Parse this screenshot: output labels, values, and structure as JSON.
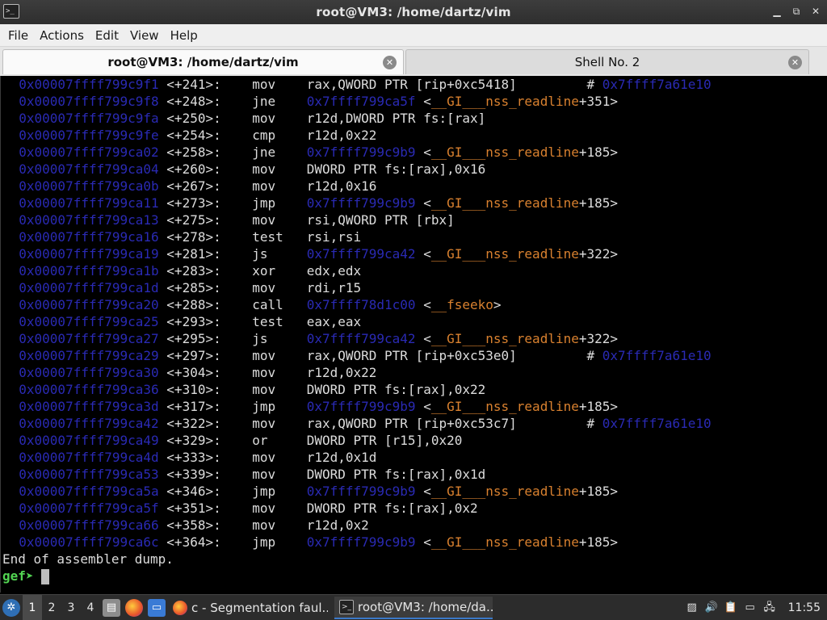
{
  "window": {
    "title": "root@VM3: /home/dartz/vim",
    "app_icon": ">_"
  },
  "menu": [
    "File",
    "Actions",
    "Edit",
    "View",
    "Help"
  ],
  "tabs": [
    {
      "label": "root@VM3: /home/dartz/vim",
      "active": true
    },
    {
      "label": "Shell No. 2",
      "active": false
    }
  ],
  "terminal": {
    "lines": [
      {
        "addr": "0x00007ffff799c9f1",
        "off": "<+241>:",
        "mn": "mov",
        "op": "rax,QWORD PTR [rip+0xc5418]",
        "comment": "0x7ffff7a61e10"
      },
      {
        "addr": "0x00007ffff799c9f8",
        "off": "<+248>:",
        "mn": "jne",
        "target": "0x7ffff799ca5f",
        "sym": "__GI___nss_readline",
        "sym_off": "+351"
      },
      {
        "addr": "0x00007ffff799c9fa",
        "off": "<+250>:",
        "mn": "mov",
        "op": "r12d,DWORD PTR fs:[rax]"
      },
      {
        "addr": "0x00007ffff799c9fe",
        "off": "<+254>:",
        "mn": "cmp",
        "op": "r12d,0x22"
      },
      {
        "addr": "0x00007ffff799ca02",
        "off": "<+258>:",
        "mn": "jne",
        "target": "0x7ffff799c9b9",
        "sym": "__GI___nss_readline",
        "sym_off": "+185"
      },
      {
        "addr": "0x00007ffff799ca04",
        "off": "<+260>:",
        "mn": "mov",
        "op": "DWORD PTR fs:[rax],0x16"
      },
      {
        "addr": "0x00007ffff799ca0b",
        "off": "<+267>:",
        "mn": "mov",
        "op": "r12d,0x16"
      },
      {
        "addr": "0x00007ffff799ca11",
        "off": "<+273>:",
        "mn": "jmp",
        "target": "0x7ffff799c9b9",
        "sym": "__GI___nss_readline",
        "sym_off": "+185"
      },
      {
        "addr": "0x00007ffff799ca13",
        "off": "<+275>:",
        "mn": "mov",
        "op": "rsi,QWORD PTR [rbx]"
      },
      {
        "addr": "0x00007ffff799ca16",
        "off": "<+278>:",
        "mn": "test",
        "op": "rsi,rsi"
      },
      {
        "addr": "0x00007ffff799ca19",
        "off": "<+281>:",
        "mn": "js",
        "target": "0x7ffff799ca42",
        "sym": "__GI___nss_readline",
        "sym_off": "+322"
      },
      {
        "addr": "0x00007ffff799ca1b",
        "off": "<+283>:",
        "mn": "xor",
        "op": "edx,edx"
      },
      {
        "addr": "0x00007ffff799ca1d",
        "off": "<+285>:",
        "mn": "mov",
        "op": "rdi,r15"
      },
      {
        "addr": "0x00007ffff799ca20",
        "off": "<+288>:",
        "mn": "call",
        "target": "0x7ffff78d1c00",
        "sym": "__fseeko",
        "sym_off": ""
      },
      {
        "addr": "0x00007ffff799ca25",
        "off": "<+293>:",
        "mn": "test",
        "op": "eax,eax"
      },
      {
        "addr": "0x00007ffff799ca27",
        "off": "<+295>:",
        "mn": "js",
        "target": "0x7ffff799ca42",
        "sym": "__GI___nss_readline",
        "sym_off": "+322"
      },
      {
        "addr": "0x00007ffff799ca29",
        "off": "<+297>:",
        "mn": "mov",
        "op": "rax,QWORD PTR [rip+0xc53e0]",
        "comment": "0x7ffff7a61e10"
      },
      {
        "addr": "0x00007ffff799ca30",
        "off": "<+304>:",
        "mn": "mov",
        "op": "r12d,0x22"
      },
      {
        "addr": "0x00007ffff799ca36",
        "off": "<+310>:",
        "mn": "mov",
        "op": "DWORD PTR fs:[rax],0x22"
      },
      {
        "addr": "0x00007ffff799ca3d",
        "off": "<+317>:",
        "mn": "jmp",
        "target": "0x7ffff799c9b9",
        "sym": "__GI___nss_readline",
        "sym_off": "+185"
      },
      {
        "addr": "0x00007ffff799ca42",
        "off": "<+322>:",
        "mn": "mov",
        "op": "rax,QWORD PTR [rip+0xc53c7]",
        "comment": "0x7ffff7a61e10"
      },
      {
        "addr": "0x00007ffff799ca49",
        "off": "<+329>:",
        "mn": "or",
        "op": "DWORD PTR [r15],0x20"
      },
      {
        "addr": "0x00007ffff799ca4d",
        "off": "<+333>:",
        "mn": "mov",
        "op": "r12d,0x1d"
      },
      {
        "addr": "0x00007ffff799ca53",
        "off": "<+339>:",
        "mn": "mov",
        "op": "DWORD PTR fs:[rax],0x1d"
      },
      {
        "addr": "0x00007ffff799ca5a",
        "off": "<+346>:",
        "mn": "jmp",
        "target": "0x7ffff799c9b9",
        "sym": "__GI___nss_readline",
        "sym_off": "+185"
      },
      {
        "addr": "0x00007ffff799ca5f",
        "off": "<+351>:",
        "mn": "mov",
        "op": "DWORD PTR fs:[rax],0x2"
      },
      {
        "addr": "0x00007ffff799ca66",
        "off": "<+358>:",
        "mn": "mov",
        "op": "r12d,0x2"
      },
      {
        "addr": "0x00007ffff799ca6c",
        "off": "<+364>:",
        "mn": "jmp",
        "target": "0x7ffff799c9b9",
        "sym": "__GI___nss_readline",
        "sym_off": "+185"
      }
    ],
    "end_message": "End of assembler dump.",
    "prompt": "gef➤"
  },
  "taskbar": {
    "workspaces": [
      "1",
      "2",
      "3",
      "4"
    ],
    "active_workspace": "1",
    "tasks": [
      {
        "label": "c - Segmentation faul...",
        "icon": "firefox-icon",
        "active": false
      },
      {
        "label": "root@VM3: /home/da...",
        "icon": "terminal-icon",
        "active": true
      }
    ],
    "clock": "11:55"
  },
  "colors": {
    "address": "#2a2ab4",
    "symbol": "#d9812f",
    "prompt": "#52d452",
    "text": "#dcdcdc",
    "background": "#000000"
  }
}
